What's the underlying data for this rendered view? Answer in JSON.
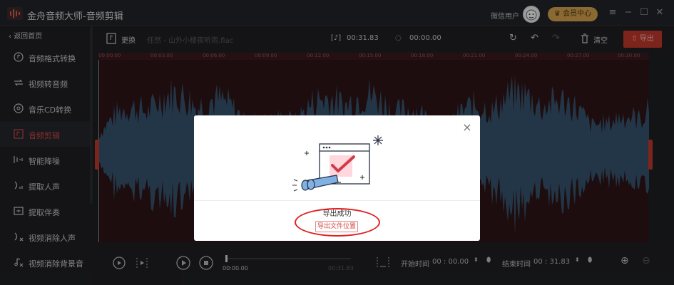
{
  "app": {
    "title": "金舟音频大师-音频剪辑",
    "user_label": "微信用户",
    "member_label": "会员中心",
    "brand_color": "#c0392b"
  },
  "sidebar": {
    "back_label": "返回首页",
    "items": [
      {
        "label": "音频格式转换",
        "icon": "audio-convert-icon"
      },
      {
        "label": "视频转音频",
        "icon": "video-to-audio-icon"
      },
      {
        "label": "音乐CD转换",
        "icon": "cd-icon"
      },
      {
        "label": "音频剪辑",
        "icon": "audio-cut-icon",
        "active": true
      },
      {
        "label": "智能降噪",
        "icon": "denoise-icon"
      },
      {
        "label": "提取人声",
        "icon": "extract-voice-icon"
      },
      {
        "label": "提取伴奏",
        "icon": "extract-accompaniment-icon"
      },
      {
        "label": "视频消除人声",
        "icon": "video-remove-voice-icon"
      },
      {
        "label": "视频消除背景音",
        "icon": "video-remove-bg-icon"
      }
    ]
  },
  "toolbar": {
    "replace_label": "更换",
    "filename": "任然 - 山外小楼夜听雨.flac",
    "duration": "00:31.83",
    "selection": "00:00.00",
    "clear_label": "清空",
    "export_label": "导出"
  },
  "timeline": {
    "ticks": [
      "00:00.00",
      "00:03.00",
      "00:06.00",
      "00:09.00",
      "00:12.00",
      "00:15.00",
      "00:18.00",
      "00:21.00",
      "00:24.00",
      "00:27.00",
      "00:30.00"
    ]
  },
  "player": {
    "current_time": "00:00.00",
    "end_time": "00:31.83",
    "start_label": "开始时间",
    "start_value": "00 : 00.00",
    "end_label": "结束时间",
    "end_value": "00 : 31.83"
  },
  "dialog": {
    "message": "导出成功",
    "locate_button": "导出文件位置"
  }
}
